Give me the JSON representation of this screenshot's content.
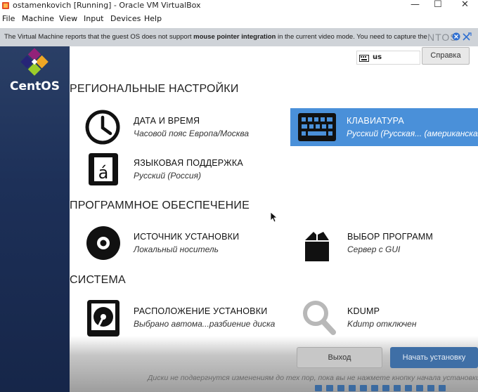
{
  "window": {
    "title": "ostamenkovich [Running] - Oracle VM VirtualBox",
    "controls": {
      "minimize": "—",
      "maximize": "☐",
      "close": "✕"
    }
  },
  "menubar": {
    "items": [
      "File",
      "Machine",
      "View",
      "Input",
      "Devices",
      "Help"
    ]
  },
  "notification": {
    "text_before": "The Virtual Machine reports that the guest OS does not support ",
    "text_bold": "mouse pointer integration",
    "text_after": " in the current video mode. You need to capture the",
    "ghost": "NTOS"
  },
  "sidebar": {
    "brand": "CentOS"
  },
  "header": {
    "keyboard_layout": "us",
    "help_label": "Справка"
  },
  "sections": {
    "regional": "РЕГИОНАЛЬНЫЕ НАСТРОЙКИ",
    "software": "ПРОГРАММНОЕ ОБЕСПЕЧЕНИЕ",
    "system": "СИСТЕМА"
  },
  "items": {
    "datetime": {
      "title": "ДАТА И ВРЕМЯ",
      "status": "Часовой пояс Европа/Москва",
      "icon": "clock-icon"
    },
    "keyboard": {
      "title": "КЛАВИАТУРА",
      "status": "Русский (Русская... (американская)",
      "icon": "keyboard-icon"
    },
    "language": {
      "title": "ЯЗЫКОВАЯ ПОДДЕРЖКА",
      "status": "Русский (Россия)",
      "icon": "language-icon"
    },
    "source": {
      "title": "ИСТОЧНИК УСТАНОВКИ",
      "status": "Локальный носитель",
      "icon": "disc-icon"
    },
    "software": {
      "title": "ВЫБОР ПРОГРАММ",
      "status": "Сервер с GUI",
      "icon": "package-icon"
    },
    "destination": {
      "title": "РАСПОЛОЖЕНИЕ УСТАНОВКИ",
      "status": "Выбрано автома...разбиение диска",
      "icon": "harddisk-icon"
    },
    "kdump": {
      "title": "KDUMP",
      "status": "Kdump отключен",
      "icon": "magnifier-icon"
    }
  },
  "footer": {
    "exit_label": "Выход",
    "start_label": "Начать установку",
    "message": "Диски не подвергнутся изменениям до тех пор, пока вы не нажмете кнопку начала установки."
  },
  "colors": {
    "accent": "#4a90d9",
    "sidebar": "#1d3058",
    "start_button": "#3f6fa6"
  }
}
